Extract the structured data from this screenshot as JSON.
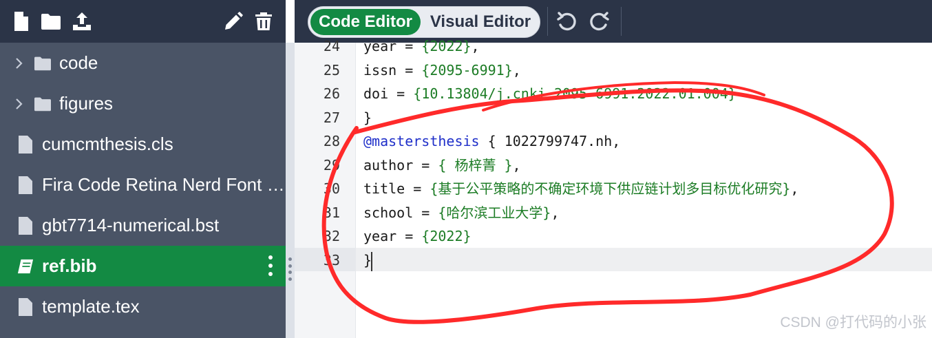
{
  "sidebar": {
    "toolbar": {
      "new_file_icon": "new-file-icon",
      "new_folder_icon": "new-folder-icon",
      "upload_icon": "upload-icon",
      "rename_icon": "pencil-icon",
      "delete_icon": "trash-icon"
    },
    "items": [
      {
        "type": "folder",
        "label": "code"
      },
      {
        "type": "folder",
        "label": "figures"
      },
      {
        "type": "file",
        "label": "cumcmthesis.cls"
      },
      {
        "type": "file",
        "label": "Fira Code Retina Nerd Font Complete.ttf"
      },
      {
        "type": "file",
        "label": "gbt7714-numerical.bst"
      },
      {
        "type": "file",
        "label": "ref.bib",
        "selected": true
      },
      {
        "type": "file",
        "label": "template.tex"
      }
    ]
  },
  "editor_toolbar": {
    "code_editor_label": "Code Editor",
    "visual_editor_label": "Visual Editor",
    "undo_icon": "undo-icon",
    "redo_icon": "redo-icon"
  },
  "editor": {
    "lines": [
      {
        "n": "24",
        "tokens": [
          {
            "t": "year = "
          },
          {
            "t": "{2022}",
            "c": "str"
          },
          {
            "t": ","
          }
        ]
      },
      {
        "n": "25",
        "tokens": [
          {
            "t": "issn = "
          },
          {
            "t": "{2095-6991}",
            "c": "str"
          },
          {
            "t": ","
          }
        ]
      },
      {
        "n": "26",
        "tokens": [
          {
            "t": "doi = "
          },
          {
            "t": "{10.13804/j.cnki.2095-6991.2022.01.004}",
            "c": "str"
          }
        ]
      },
      {
        "n": "27",
        "tokens": [
          {
            "t": "}"
          }
        ]
      },
      {
        "n": "28",
        "tokens": [
          {
            "t": "@mastersthesis",
            "c": "kw"
          },
          {
            "t": " { 1022799747.nh,"
          }
        ]
      },
      {
        "n": "29",
        "tokens": [
          {
            "t": "author = "
          },
          {
            "t": "{ 杨梓菁 }",
            "c": "str"
          },
          {
            "t": ","
          }
        ]
      },
      {
        "n": "30",
        "tokens": [
          {
            "t": "title = "
          },
          {
            "t": "{基于公平策略的不确定环境下供应链计划多目标优化研究}",
            "c": "str"
          },
          {
            "t": ","
          }
        ]
      },
      {
        "n": "31",
        "tokens": [
          {
            "t": "school = "
          },
          {
            "t": "{哈尔滨工业大学}",
            "c": "str"
          },
          {
            "t": ","
          }
        ]
      },
      {
        "n": "32",
        "tokens": [
          {
            "t": "year = "
          },
          {
            "t": "{2022}",
            "c": "str"
          }
        ]
      },
      {
        "n": "33",
        "tokens": [
          {
            "t": "}"
          }
        ]
      }
    ]
  },
  "annotation_color": "#ff2a2a",
  "accent_color": "#138a43",
  "watermark": "CSDN @打代码的小张"
}
